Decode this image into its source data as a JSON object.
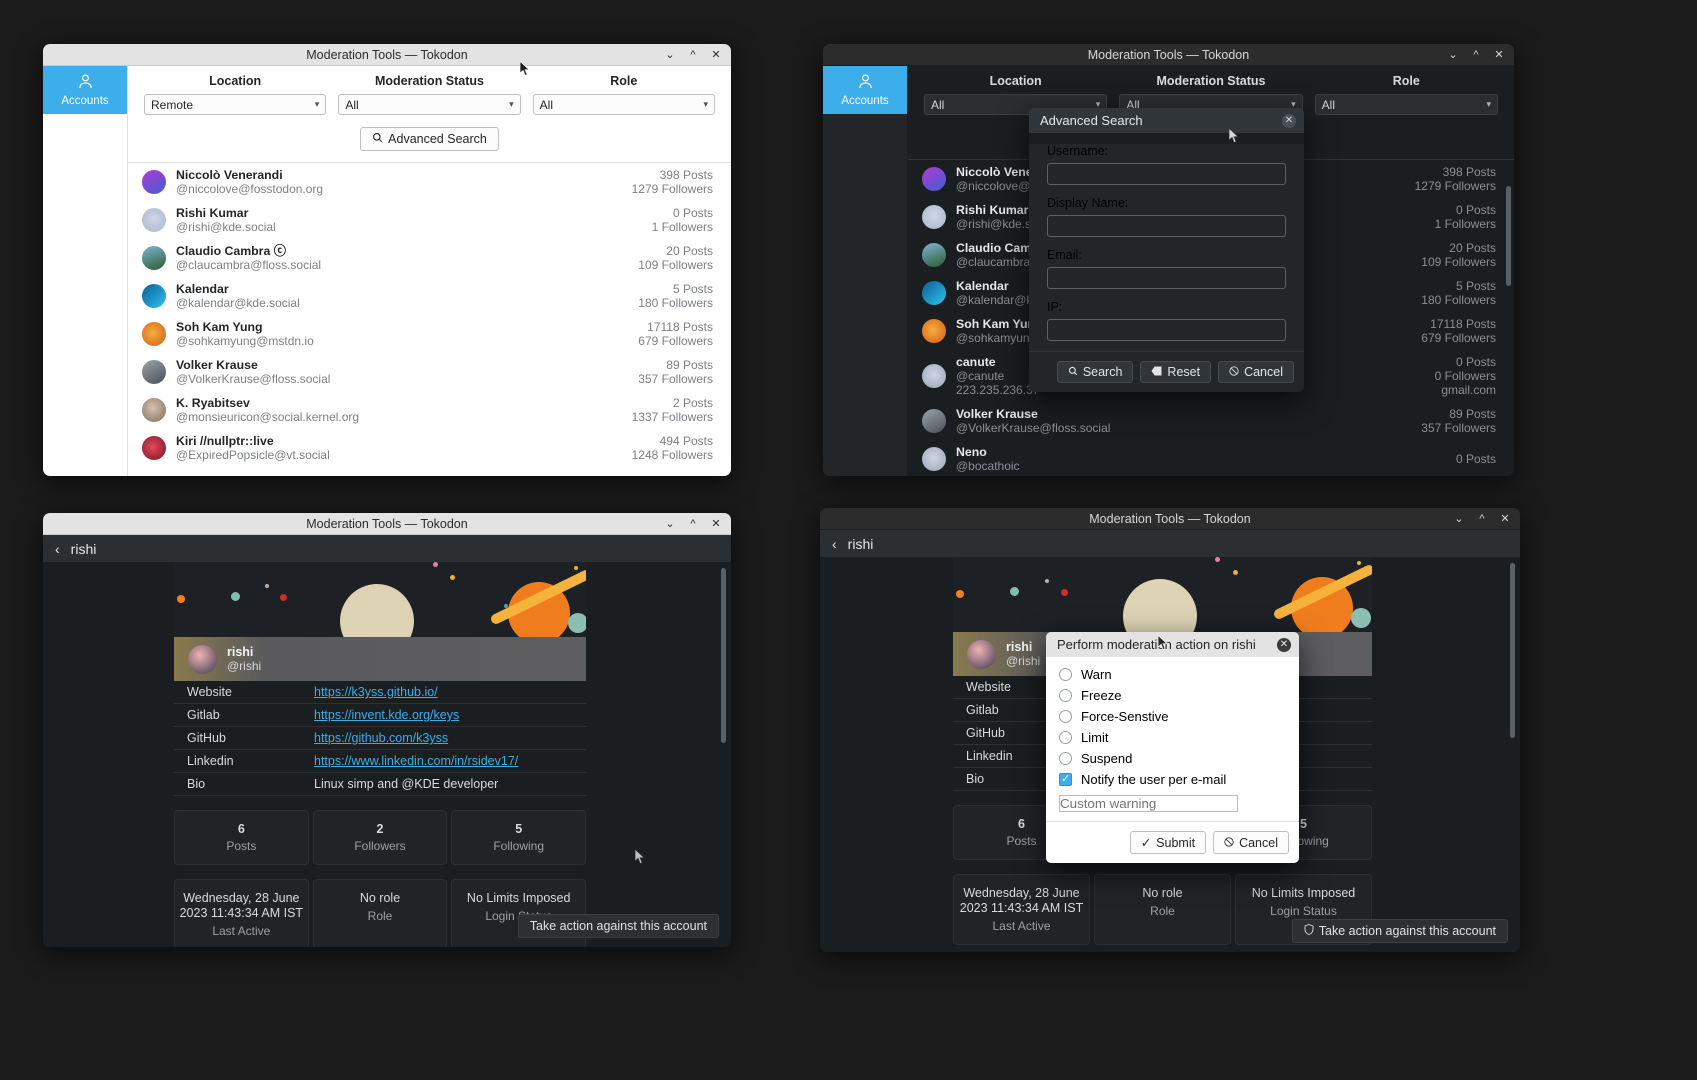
{
  "window_title": "Moderation Tools — Tokodon",
  "titlebar_buttons": {
    "minimize": "⌄",
    "maximize": "^",
    "close": "✕"
  },
  "sidebar": {
    "items": [
      {
        "label": "Accounts",
        "icon": "person-icon",
        "selected": true
      }
    ]
  },
  "filters": {
    "location": {
      "label": "Location",
      "value_w1": "Remote",
      "value_w2": "All"
    },
    "moderation_status": {
      "label": "Moderation Status",
      "value": "All"
    },
    "role": {
      "label": "Role",
      "value": "All"
    }
  },
  "advanced_search_button": {
    "label": "Advanced Search",
    "icon": "search-icon"
  },
  "accounts": [
    {
      "name": "Niccolò Venerandi",
      "handle": "@niccolove@fosstodon.org",
      "posts": "398 Posts",
      "followers": "1279 Followers",
      "avatar": "avatar-niccolo"
    },
    {
      "name": "Rishi Kumar",
      "handle": "@rishi@kde.social",
      "posts": "0 Posts",
      "followers": "1 Followers",
      "avatar": "avatar-rishi"
    },
    {
      "name": "Claudio Cambra ⓒ",
      "handle": "@claucambra@floss.social",
      "posts": "20 Posts",
      "followers": "109 Followers",
      "avatar": "avatar-claudio"
    },
    {
      "name": "Kalendar",
      "handle": "@kalendar@kde.social",
      "posts": "5 Posts",
      "followers": "180 Followers",
      "avatar": "avatar-kalendar"
    },
    {
      "name": "Soh Kam Yung",
      "handle": "@sohkamyung@mstdn.io",
      "posts": "17118 Posts",
      "followers": "679 Followers",
      "avatar": "avatar-soh"
    },
    {
      "name": "Volker Krause",
      "handle": "@VolkerKrause@floss.social",
      "posts": "89 Posts",
      "followers": "357 Followers",
      "avatar": "avatar-volker"
    },
    {
      "name": "K. Ryabitsev",
      "handle": "@monsieuricon@social.kernel.org",
      "posts": "2 Posts",
      "followers": "1337 Followers",
      "avatar": "avatar-konstantin"
    },
    {
      "name": "Kiri //nullptr::live",
      "handle": "@ExpiredPopsicle@vt.social",
      "posts": "494 Posts",
      "followers": "1248 Followers",
      "avatar": "avatar-kiri"
    }
  ],
  "accounts_dark": [
    {
      "name": "Niccolò Vener",
      "handle": "@niccolove@fos",
      "posts": "398 Posts",
      "followers": "1279 Followers",
      "extra": "",
      "avatar": "avatar-niccolo"
    },
    {
      "name": "Rishi Kumar",
      "handle": "@rishi@kde.soc",
      "posts": "0 Posts",
      "followers": "1 Followers",
      "extra": "",
      "avatar": "avatar-rishi"
    },
    {
      "name": "Claudio Camb",
      "handle": "@claucambra@",
      "posts": "20 Posts",
      "followers": "109 Followers",
      "extra": "",
      "avatar": "avatar-claudio"
    },
    {
      "name": "Kalendar",
      "handle": "@kalendar@kd",
      "posts": "5 Posts",
      "followers": "180 Followers",
      "extra": "",
      "avatar": "avatar-kalendar"
    },
    {
      "name": "Soh Kam Yung",
      "handle": "@sohkamyung",
      "posts": "17118 Posts",
      "followers": "679 Followers",
      "extra": "",
      "avatar": "avatar-soh"
    },
    {
      "name": "canute",
      "handle": "@canute",
      "handle2": "223.235.236.37",
      "posts": "0 Posts",
      "followers": "0 Followers",
      "extra": "gmail.com",
      "avatar": "avatar-canute"
    },
    {
      "name": "Volker Krause",
      "handle": "@VolkerKrause@floss.social",
      "posts": "89 Posts",
      "followers": "357 Followers",
      "extra": "",
      "avatar": "avatar-volker"
    },
    {
      "name": "Neno",
      "handle": "@bocathoic",
      "posts": "0 Posts",
      "followers": "",
      "extra": "",
      "avatar": "avatar-neno"
    }
  ],
  "advanced_search_dialog": {
    "title": "Advanced Search",
    "close_icon": "close-icon",
    "fields": [
      {
        "label": "Username:",
        "value": ""
      },
      {
        "label": "Display Name:",
        "value": ""
      },
      {
        "label": "Email:",
        "value": ""
      },
      {
        "label": "IP:",
        "value": ""
      }
    ],
    "buttons": {
      "search": "Search",
      "reset": "Reset",
      "cancel": "Cancel"
    }
  },
  "profile": {
    "header_title": "rishi",
    "back_icon": "back-arrow-icon",
    "display_name": "rishi",
    "handle": "@rishi",
    "info_rows": [
      {
        "key": "Website",
        "value": "https://k3yss.github.io/",
        "is_link": true
      },
      {
        "key": "Gitlab",
        "value": "https://invent.kde.org/keys",
        "is_link": true
      },
      {
        "key": "GitHub",
        "value": "https://github.com/k3yss",
        "is_link": true
      },
      {
        "key": "Linkedin",
        "value": "https://www.linkedin.com/in/rsidev17/",
        "is_link": true
      },
      {
        "key": "Bio",
        "value": "Linux simp and @KDE developer",
        "is_link": false
      }
    ],
    "stats": [
      {
        "big": "6",
        "small": "Posts"
      },
      {
        "big": "2",
        "small": "Followers"
      },
      {
        "big": "5",
        "small": "Following"
      }
    ],
    "meta": [
      {
        "big": "Wednesday, 28 June 2023 11:43:34 AM IST",
        "small": "Last Active"
      },
      {
        "big": "No role",
        "small": "Role"
      },
      {
        "big": "No Limits Imposed",
        "small": "Login Status"
      }
    ],
    "take_action_label": "Take action against this account",
    "take_action_icon": "shield-icon"
  },
  "moderation_dialog": {
    "title": "Perform moderation action on rishi",
    "close_icon": "close-icon",
    "options": [
      {
        "label": "Warn",
        "checked": false
      },
      {
        "label": "Freeze",
        "checked": false
      },
      {
        "label": "Force-Senstive",
        "checked": false
      },
      {
        "label": "Limit",
        "checked": false
      },
      {
        "label": "Suspend",
        "checked": false
      }
    ],
    "checkbox": {
      "label": "Notify the user per e-mail",
      "checked": true
    },
    "custom_warning_placeholder": "Custom warning",
    "custom_warning_value": "",
    "buttons": {
      "submit": "Submit",
      "cancel": "Cancel"
    }
  },
  "colors": {
    "accent": "#3daee9",
    "link": "#3daee9",
    "dark_bg": "#1b1e20",
    "light_bg": "#ffffff"
  }
}
